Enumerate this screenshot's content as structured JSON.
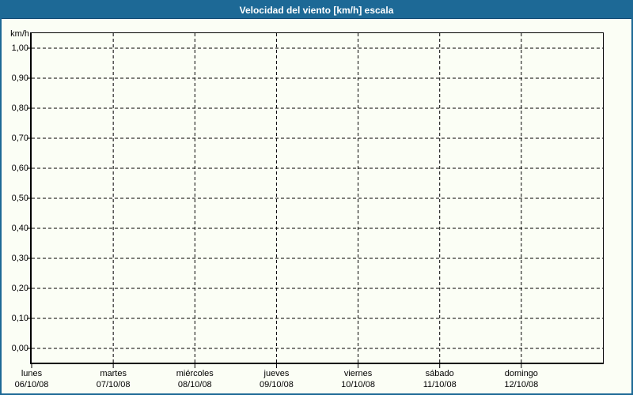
{
  "window": {
    "title_bar": "Velocidad del viento [km/h] escala"
  },
  "chart_data": {
    "type": "line",
    "title": "Velocidad del viento [km/h] escala",
    "ylabel": "km/h",
    "ylim": [
      0.0,
      1.0
    ],
    "y_tick_step": 0.1,
    "y_tick_labels": [
      "1,00",
      "0,90",
      "0,80",
      "0,70",
      "0,60",
      "0,50",
      "0,40",
      "0,30",
      "0,20",
      "0,10",
      "0,00"
    ],
    "categories": [
      {
        "day": "lunes",
        "date": "06/10/08"
      },
      {
        "day": "martes",
        "date": "07/10/08"
      },
      {
        "day": "miércoles",
        "date": "08/10/08"
      },
      {
        "day": "jueves",
        "date": "09/10/08"
      },
      {
        "day": "viernes",
        "date": "10/10/08"
      },
      {
        "day": "sábado",
        "date": "11/10/08"
      },
      {
        "day": "domingo",
        "date": "12/10/08"
      }
    ],
    "series": [],
    "grid": "dashed",
    "legend_position": "none"
  },
  "colors": {
    "title_bar_bg": "#1d6996",
    "title_text": "#ffffff",
    "window_border": "#1d6996",
    "plot_background": "#fbfef5",
    "grid_line": "#000000",
    "axis_line": "#000000",
    "label_text": "#000000"
  }
}
